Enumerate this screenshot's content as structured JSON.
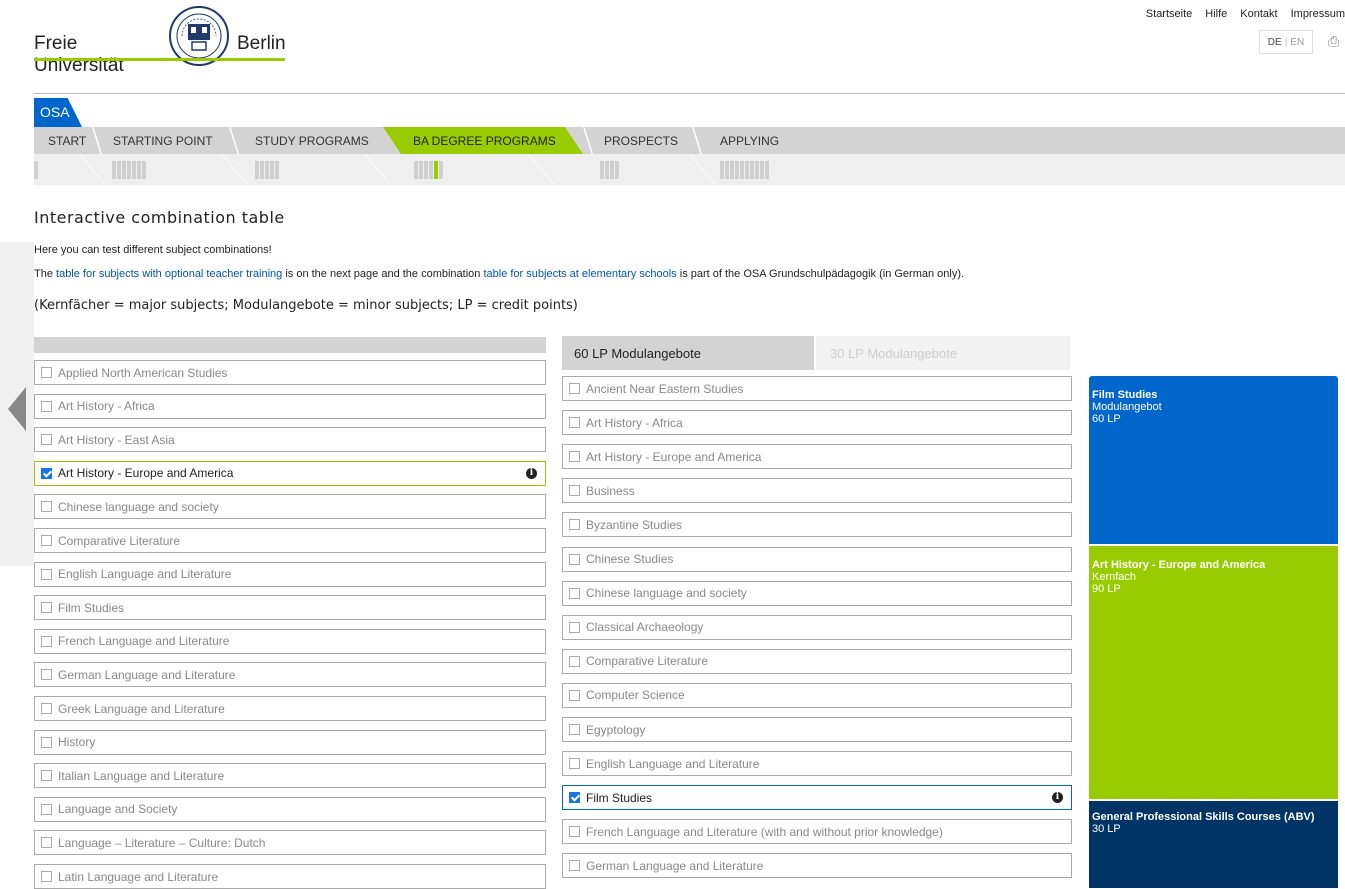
{
  "header": {
    "top_links": [
      "Startseite",
      "Hilfe",
      "Kontakt",
      "Impressum"
    ],
    "logo_left": "Freie Universität",
    "logo_right": "Berlin",
    "lang_de": "DE",
    "lang_sep": "|",
    "lang_en": "EN",
    "print_icon": "printer-icon"
  },
  "nav": {
    "osa": "OSA",
    "tabs": [
      "START",
      "STARTING POINT",
      "STUDY PROGRAMS",
      "BA DEGREE PROGRAMS",
      "PROSPECTS",
      "APPLYING"
    ],
    "active_tab": "BA DEGREE PROGRAMS",
    "progress": [
      {
        "total": 1,
        "done": 0
      },
      {
        "total": 7,
        "done": 0
      },
      {
        "total": 5,
        "done": 0
      },
      {
        "total": 6,
        "done": 4
      },
      {
        "total": 4,
        "done": 0
      },
      {
        "total": 10,
        "done": 0
      }
    ]
  },
  "page": {
    "title": "Interactive combination table",
    "intro": "Here you can test different subject combinations!",
    "line2_a": "The ",
    "link1": "table for subjects with optional teacher training",
    "line2_b": " is on the next page and the combination ",
    "link2": "table for subjects at elementary schools",
    "line2_c": " is part of the OSA Grundschulpädagogik (in German only).",
    "legend": "(Kernfächer = major subjects; Modulangebote = minor subjects; LP = credit points)"
  },
  "major_subjects": [
    {
      "label": "Applied North American Studies",
      "checked": false
    },
    {
      "label": "Art History - Africa",
      "checked": false
    },
    {
      "label": "Art History - East Asia",
      "checked": false
    },
    {
      "label": "Art History - Europe and America",
      "checked": true
    },
    {
      "label": "Chinese language and society",
      "checked": false
    },
    {
      "label": "Comparative Literature",
      "checked": false
    },
    {
      "label": "English Language and Literature",
      "checked": false
    },
    {
      "label": "Film Studies",
      "checked": false
    },
    {
      "label": "French Language and Literature",
      "checked": false
    },
    {
      "label": "German Language and Literature",
      "checked": false
    },
    {
      "label": "Greek Language and Literature",
      "checked": false
    },
    {
      "label": "History",
      "checked": false
    },
    {
      "label": "Italian Language and Literature",
      "checked": false
    },
    {
      "label": "Language and Society",
      "checked": false
    },
    {
      "label": "Language – Literature – Culture: Dutch",
      "checked": false
    },
    {
      "label": "Latin Language and Literature",
      "checked": false
    }
  ],
  "minor_tabs": {
    "tab_60": "60 LP Modulangebote",
    "tab_30": "30 LP Modulangebote"
  },
  "minor_subjects": [
    {
      "label": "Ancient Near Eastern Studies",
      "checked": false
    },
    {
      "label": "Art History - Africa",
      "checked": false
    },
    {
      "label": "Art History - Europe and America",
      "checked": false
    },
    {
      "label": "Business",
      "checked": false
    },
    {
      "label": "Byzantine Studies",
      "checked": false
    },
    {
      "label": "Chinese Studies",
      "checked": false
    },
    {
      "label": "Chinese language and society",
      "checked": false
    },
    {
      "label": "Classical Archaeology",
      "checked": false
    },
    {
      "label": "Comparative Literature",
      "checked": false
    },
    {
      "label": "Computer Science",
      "checked": false
    },
    {
      "label": "Egyptology",
      "checked": false
    },
    {
      "label": "English Language and Literature",
      "checked": false
    },
    {
      "label": "Film Studies",
      "checked": true
    },
    {
      "label": "French Language and Literature (with and without prior knowledge)",
      "checked": false
    },
    {
      "label": "German Language and Literature",
      "checked": false
    }
  ],
  "summary": {
    "minor": {
      "title": "Film Studies",
      "type": "Modulangebot",
      "lp": "60 LP"
    },
    "major": {
      "title": "Art History - Europe and America",
      "type": "Kernfach",
      "lp": "90 LP"
    },
    "abv": {
      "title": "General Professional Skills Courses (ABV)",
      "lp": "30 LP"
    },
    "colors": {
      "minor": "#0066cc",
      "major": "#99cc00",
      "abv": "#003366"
    }
  }
}
